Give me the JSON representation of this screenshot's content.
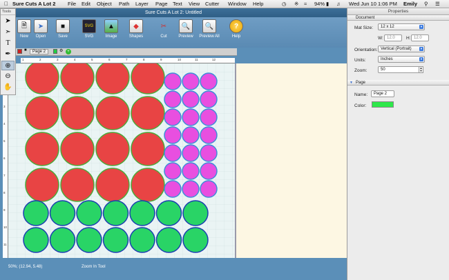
{
  "menubar": {
    "app_name": "Sure Cuts A Lot 2",
    "items": [
      "File",
      "Edit",
      "Object",
      "Path",
      "Layer",
      "Page",
      "Text",
      "View",
      "Cutter",
      "Window",
      "Help"
    ],
    "battery": "94%",
    "datetime": "Wed Jun 10  1:06 PM",
    "user": "Emily"
  },
  "window": {
    "title": "Sure Cuts A Lot 2: Untitled"
  },
  "toolbar": [
    {
      "label": "New",
      "icon": "new-icon"
    },
    {
      "label": "Open",
      "icon": "open-icon"
    },
    {
      "label": "Save",
      "icon": "save-icon"
    },
    {
      "label": "SVG",
      "icon": "svg-icon"
    },
    {
      "label": "Image",
      "icon": "image-icon"
    },
    {
      "label": "Shapes",
      "icon": "shapes-icon"
    },
    {
      "label": "Cut",
      "icon": "scissors-icon"
    },
    {
      "label": "Preview",
      "icon": "preview-icon"
    },
    {
      "label": "Preview All",
      "icon": "preview-all-icon"
    },
    {
      "label": "Help",
      "icon": "help-icon"
    }
  ],
  "tools": {
    "title": "Tools"
  },
  "tab": {
    "name": "Page 2"
  },
  "rulers": {
    "top": [
      "1",
      "2",
      "3",
      "4",
      "5",
      "6",
      "7",
      "8",
      "9",
      "10",
      "11",
      "12"
    ],
    "left": [
      "1",
      "2",
      "3",
      "4",
      "5",
      "6",
      "7",
      "8",
      "9",
      "10",
      "11"
    ]
  },
  "status": {
    "coords": "50%; (12.94, 5.48)",
    "tool": "Zoom In Tool"
  },
  "properties": {
    "title": "Properties",
    "document_section": "Document",
    "mat_size_label": "Mat Size:",
    "mat_size": "12 x 12",
    "w_label": "W:",
    "w_value": "12.0",
    "h_label": "H:",
    "h_value": "12.0",
    "orientation_label": "Orientation:",
    "orientation": "Vertical (Portrait)",
    "units_label": "Units:",
    "units": "Inches",
    "zoom_label": "Zoom:",
    "zoom": "50",
    "page_section": "Page",
    "name_label": "Name:",
    "name": "Page 2",
    "color_label": "Color:"
  },
  "colors": {
    "red_circle": "#e84444",
    "red_stroke": "#4caa3a",
    "magenta_circle": "#e84fe0",
    "magenta_stroke": "#3f8ed8",
    "green_circle": "#29d466",
    "green_stroke": "#1a3fb0",
    "page_color": "#2ee84a",
    "window_blue": "#5b8fb8"
  }
}
